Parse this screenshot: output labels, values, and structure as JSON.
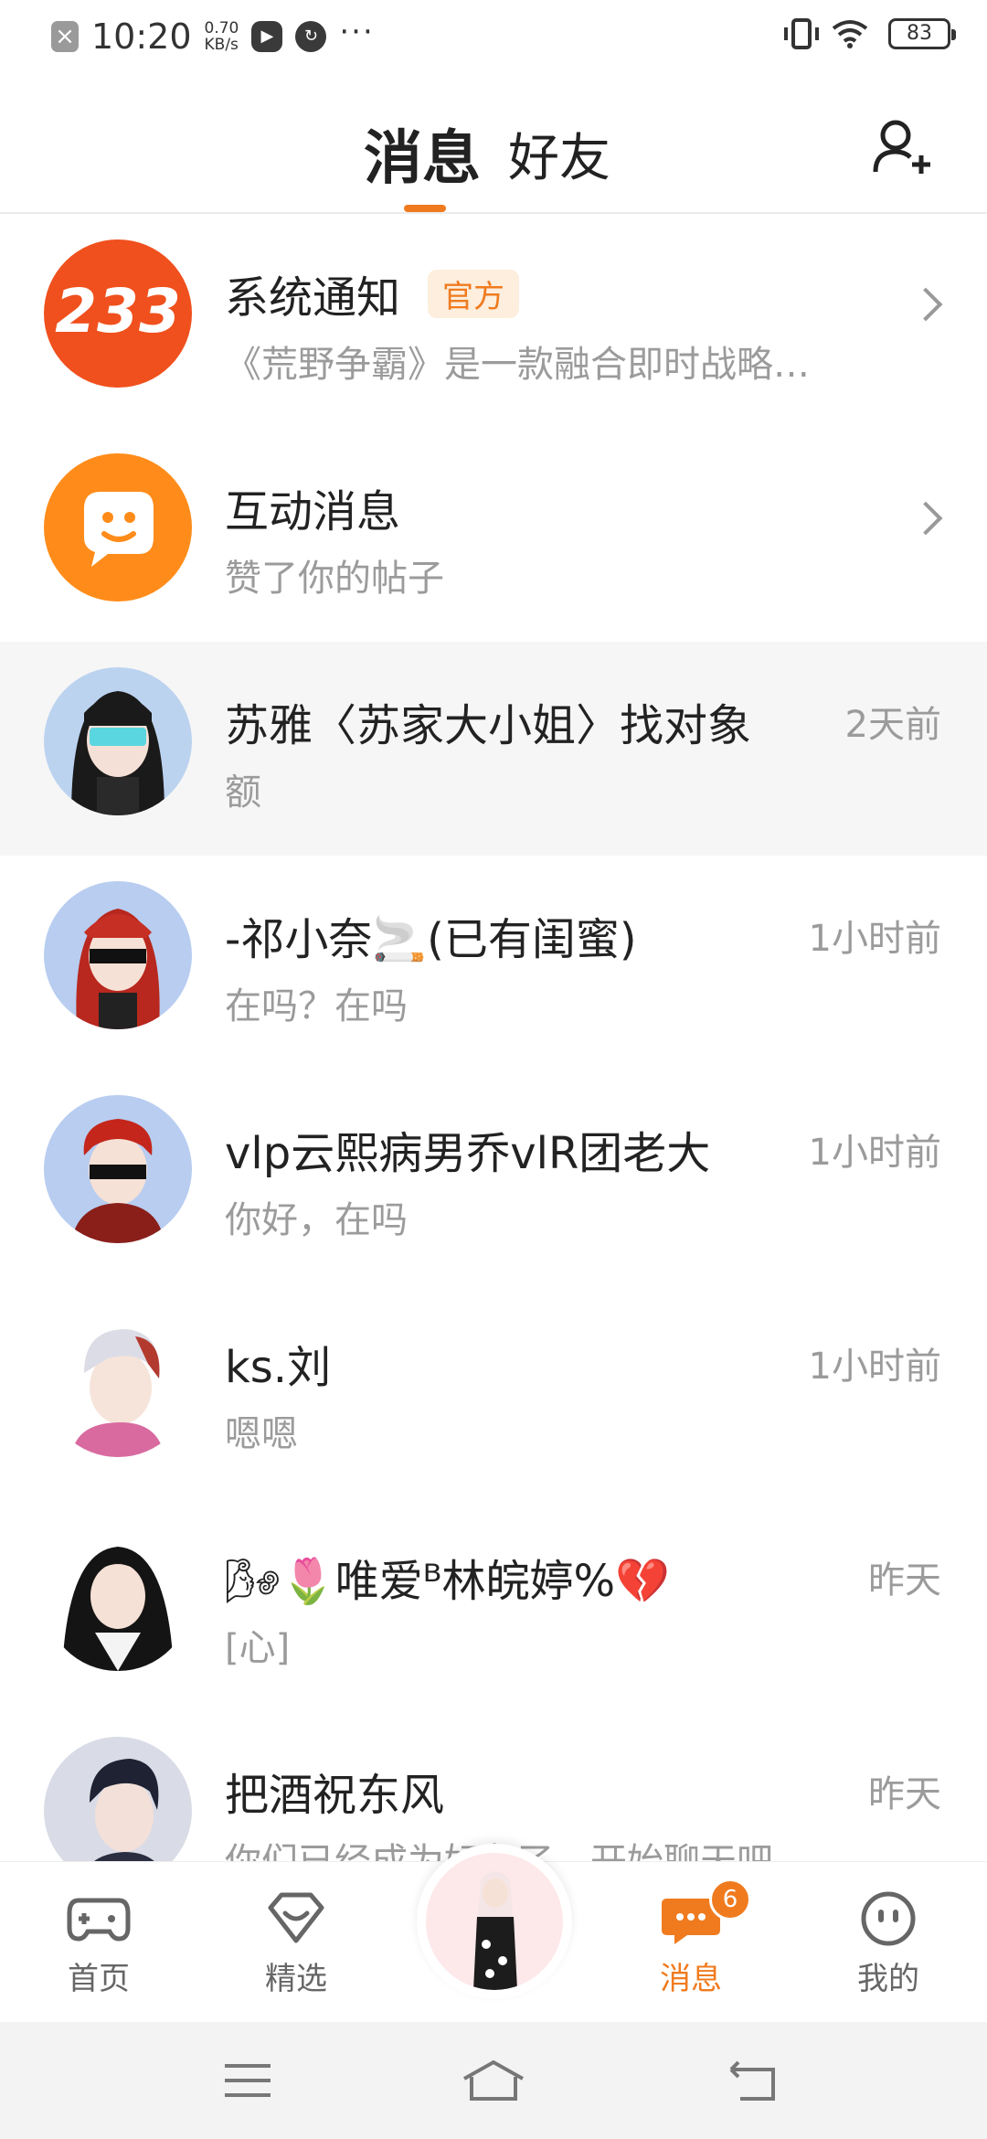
{
  "status_bar": {
    "time": "10:20",
    "speed_value": "0.70",
    "speed_unit": "KB/s",
    "more": "···",
    "battery": "83"
  },
  "header": {
    "tab_messages": "消息",
    "tab_friends": "好友"
  },
  "messages": [
    {
      "name": "系统通知",
      "badge": "官方",
      "preview": "《荒野争霸》是一款融合即时战略…",
      "avatar_text": "233"
    },
    {
      "name": "互动消息",
      "preview": "赞了你的帖子"
    },
    {
      "name": "苏雅〈苏家大小姐〉找对象",
      "time": "2天前",
      "preview": "额"
    },
    {
      "name": "-祁小奈🚬(已有闺蜜)",
      "time": "1小时前",
      "preview": "在吗？在吗"
    },
    {
      "name": "vlp云熙病男乔vlR团老大",
      "time": "1小时前",
      "preview": "你好，在吗"
    },
    {
      "name": "ks.刘",
      "time": "1小时前",
      "preview": "嗯嗯"
    },
    {
      "name": "🌬🌷唯爱ᴮ林皖婷%💔",
      "time": "昨天",
      "preview": "[心]"
    },
    {
      "name": "把酒祝东风",
      "time": "昨天",
      "preview": "你们已经成为好友了，开始聊天吧"
    }
  ],
  "bottom_nav": {
    "home": "首页",
    "featured": "精选",
    "messages": "消息",
    "messages_badge": "6",
    "mine": "我的"
  },
  "colors": {
    "accent": "#f07b1f"
  }
}
